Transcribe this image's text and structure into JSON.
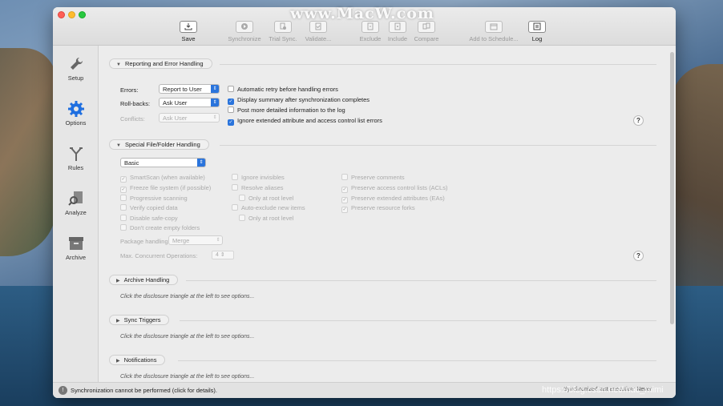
{
  "watermark": "www.MacW.com",
  "footer_watermark": "https://blog.csdn.net/mac_mimi",
  "toolbar": [
    {
      "label": "Save",
      "icon": "save-icon",
      "active": true
    },
    {
      "label": "Synchronize",
      "icon": "play-icon",
      "active": false
    },
    {
      "label": "Trial Sync.",
      "icon": "trial-sync-icon",
      "active": false
    },
    {
      "label": "Validate...",
      "icon": "validate-icon",
      "active": false
    },
    {
      "label": "Exclude",
      "icon": "exclude-icon",
      "active": false
    },
    {
      "label": "Include",
      "icon": "include-icon",
      "active": false
    },
    {
      "label": "Compare",
      "icon": "compare-icon",
      "active": false
    },
    {
      "label": "Add to Schedule...",
      "icon": "schedule-icon",
      "active": false
    },
    {
      "label": "Log",
      "icon": "log-icon",
      "active": true
    }
  ],
  "sidebar": [
    {
      "label": "Setup",
      "icon": "wrench-icon"
    },
    {
      "label": "Options",
      "icon": "gear-icon",
      "selected": true
    },
    {
      "label": "Rules",
      "icon": "rules-fork-icon"
    },
    {
      "label": "Analyze",
      "icon": "magnifier-doc-icon"
    },
    {
      "label": "Archive",
      "icon": "archive-box-icon"
    }
  ],
  "reporting": {
    "title": "Reporting and Error Handling",
    "errors_label": "Errors:",
    "errors_value": "Report to User",
    "rollbacks_label": "Roll-backs:",
    "rollbacks_value": "Ask User",
    "conflicts_label": "Conflicts:",
    "conflicts_value": "Ask User",
    "checks": [
      {
        "label": "Automatic retry before handling errors",
        "checked": false
      },
      {
        "label": "Display summary after synchronization completes",
        "checked": true
      },
      {
        "label": "Post more detailed information to the log",
        "checked": false
      },
      {
        "label": "Ignore extended attribute and access control list errors",
        "checked": true
      }
    ]
  },
  "special": {
    "title": "Special File/Folder Handling",
    "mode": "Basic",
    "col1": [
      {
        "label": "SmartScan (when available)",
        "checked": true
      },
      {
        "label": "Freeze file system (if possible)",
        "checked": true
      },
      {
        "label": "Progressive scanning",
        "checked": false
      },
      {
        "label": "Verify copied data",
        "checked": false
      },
      {
        "label": "Disable safe-copy",
        "checked": false
      },
      {
        "label": "Don't create empty folders",
        "checked": false
      }
    ],
    "col2": [
      {
        "label": "Ignore invisibles",
        "checked": false
      },
      {
        "label": "Resolve aliases",
        "checked": false
      },
      {
        "label": "Only at root level",
        "checked": false
      },
      {
        "label": "Auto-exclude new items",
        "checked": false
      },
      {
        "label": "Only at root level",
        "checked": false
      }
    ],
    "col3": [
      {
        "label": "Preserve comments",
        "checked": false
      },
      {
        "label": "Preserve access control lists (ACLs)",
        "checked": true
      },
      {
        "label": "Preserve extended attributes (EAs)",
        "checked": true
      },
      {
        "label": "Preserve resource forks",
        "checked": true
      }
    ],
    "package_label": "Package handling:",
    "package_value": "Merge",
    "concurrent_label": "Max. Concurrent Operations:",
    "concurrent_value": "4"
  },
  "collapsed_sections": [
    {
      "title": "Archive Handling",
      "hint": "Click the disclosure triangle at the left to see options..."
    },
    {
      "title": "Sync Triggers",
      "hint": "Click the disclosure triangle at the left to see options..."
    },
    {
      "title": "Notifications",
      "hint": "Click the disclosure triangle at the left to see options..."
    }
  ],
  "help_label": "?",
  "status": {
    "message": "Synchronization cannot be performed (click for details).",
    "right": "Synchronized last execution: Never"
  }
}
